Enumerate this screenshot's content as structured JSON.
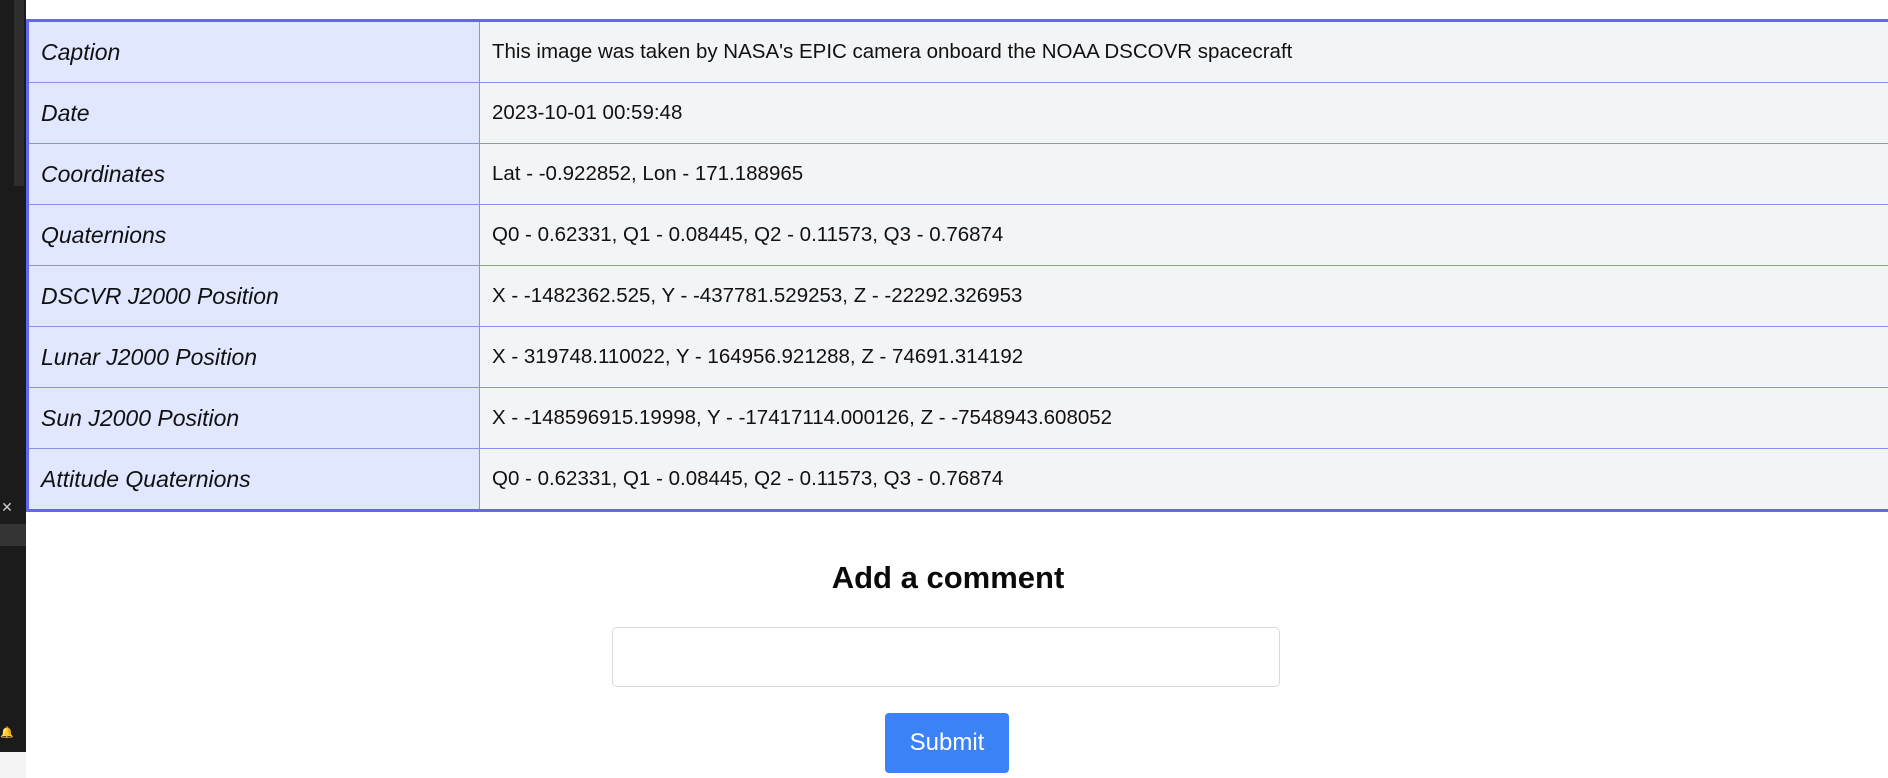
{
  "metadata_table": {
    "rows": [
      {
        "label": "Caption",
        "value": "This image was taken by NASA's EPIC camera onboard the NOAA DSCOVR spacecraft"
      },
      {
        "label": "Date",
        "value": "2023-10-01 00:59:48"
      },
      {
        "label": "Coordinates",
        "value": "Lat - -0.922852, Lon - 171.188965"
      },
      {
        "label": "Quaternions",
        "value": "Q0 - 0.62331, Q1 - 0.08445, Q2 - 0.11573, Q3 - 0.76874"
      },
      {
        "label": "DSCVR J2000 Position",
        "value": "X - -1482362.525, Y - -437781.529253, Z - -22292.326953"
      },
      {
        "label": "Lunar J2000 Position",
        "value": "X - 319748.110022, Y - 164956.921288, Z - 74691.314192"
      },
      {
        "label": "Sun J2000 Position",
        "value": "X - -148596915.19998, Y - -17417114.000126, Z - -7548943.608052"
      },
      {
        "label": "Attitude Quaternions",
        "value": "Q0 - 0.62331, Q1 - 0.08445, Q2 - 0.11573, Q3 - 0.76874"
      }
    ]
  },
  "comment": {
    "title": "Add a comment",
    "input_value": "",
    "submit_label": "Submit"
  },
  "colors": {
    "table_border": "#6366f1",
    "label_bg": "#e0e7ff",
    "value_bg": "#f3f4f6",
    "submit_bg": "#3b82f6"
  },
  "left_panel": {
    "close_icon": "close-icon",
    "bell_icon": "bell-icon"
  }
}
